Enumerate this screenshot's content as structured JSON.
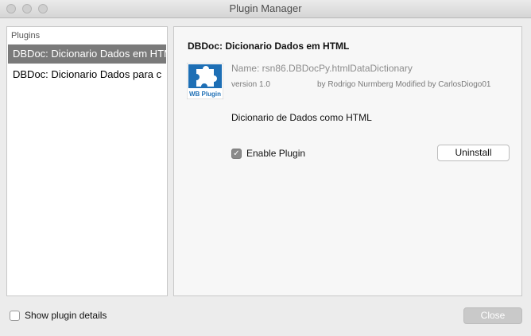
{
  "window": {
    "title": "Plugin Manager"
  },
  "plugin_list": {
    "header": "Plugins",
    "items": [
      {
        "label": "DBDoc: Dicionario Dados em HTML",
        "selected": true
      },
      {
        "label": "DBDoc: Dicionario Dados para c",
        "selected": false
      }
    ]
  },
  "details": {
    "title": "DBDoc: Dicionario Dados em HTML",
    "logo_icon": "wb-plugin-puzzle-icon",
    "logo_text": "WB Plugin",
    "name": "Name: rsn86.DBDocPy.htmlDataDictionary",
    "version": "version 1.0",
    "author": "by Rodrigo Nurmberg Modified by CarlosDiogo01",
    "description": "Dicionario de Dados como HTML",
    "enable_label": "Enable Plugin",
    "enabled": true,
    "uninstall_label": "Uninstall"
  },
  "footer": {
    "show_details_label": "Show plugin details",
    "show_details_checked": false,
    "close_label": "Close"
  },
  "colors": {
    "selection": "#7a7a7a",
    "logo_blue": "#1e6fb5"
  }
}
